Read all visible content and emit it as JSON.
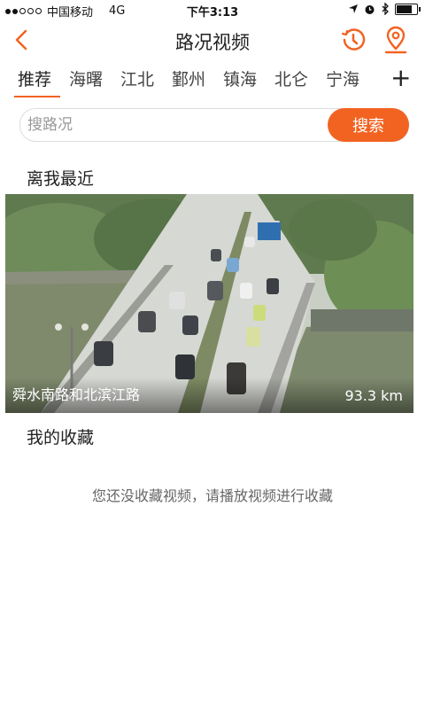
{
  "status_bar": {
    "carrier": "中国移动",
    "network": "4G",
    "time": "下午3:13",
    "signal_dots_filled": 2,
    "signal_dots_total": 5,
    "battery_level": 0.85
  },
  "header": {
    "title": "路况视频",
    "back_icon": "chevron-left-icon",
    "history_icon": "history-clock-icon",
    "location_icon": "location-pin-icon",
    "accent_color": "#f26322"
  },
  "tabs": [
    {
      "label": "推荐",
      "active": true
    },
    {
      "label": "海曙"
    },
    {
      "label": "江北"
    },
    {
      "label": "鄞州"
    },
    {
      "label": "镇海"
    },
    {
      "label": "北仑"
    },
    {
      "label": "宁海"
    }
  ],
  "add_tab_label": "+",
  "search": {
    "placeholder": "搜路况",
    "button_label": "搜索"
  },
  "nearby": {
    "title": "离我最近",
    "video": {
      "name": "舜水南路和北滨江路",
      "distance": "93.3 km"
    }
  },
  "favorites": {
    "title": "我的收藏",
    "empty_message": "您还没收藏视频，请播放视频进行收藏"
  }
}
